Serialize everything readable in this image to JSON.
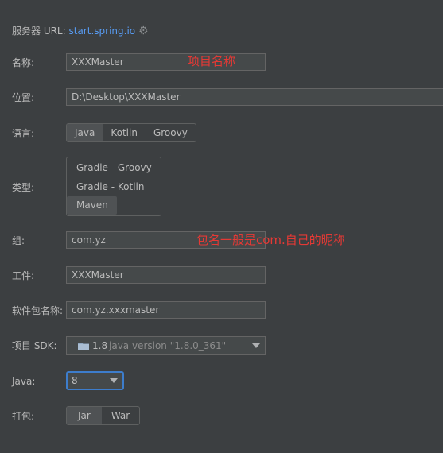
{
  "server": {
    "label": "服务器 URL:",
    "link": "start.spring.io",
    "icon": "gear-icon"
  },
  "name": {
    "label": "名称:",
    "value": "XXXMaster",
    "annotation": "项目名称"
  },
  "location": {
    "label": "位置:",
    "value": "D:\\Desktop\\XXXMaster"
  },
  "language": {
    "label": "语言:",
    "options": [
      "Java",
      "Kotlin",
      "Groovy"
    ],
    "selected": "Java"
  },
  "type": {
    "label": "类型:",
    "options": [
      "Gradle - Groovy",
      "Gradle - Kotlin",
      "Maven"
    ],
    "selected": "Maven"
  },
  "group": {
    "label": "组:",
    "value": "com.yz",
    "annotation": "包名一般是com.自己的昵称"
  },
  "artifact": {
    "label": "工件:",
    "value": "XXXMaster"
  },
  "package": {
    "label": "软件包名称:",
    "value": "com.yz.xxxmaster"
  },
  "sdk": {
    "label": "项目 SDK:",
    "version": "1.8",
    "detail": "java version \"1.8.0_361\"",
    "icon": "folder-icon"
  },
  "java": {
    "label": "Java:",
    "value": "8"
  },
  "packaging": {
    "label": "打包:",
    "options": [
      "Jar",
      "War"
    ],
    "selected": "Jar"
  },
  "colors": {
    "background": "#3c3f41",
    "link": "#589df6",
    "annotation": "#e53935",
    "focus": "#3d7dcc"
  }
}
